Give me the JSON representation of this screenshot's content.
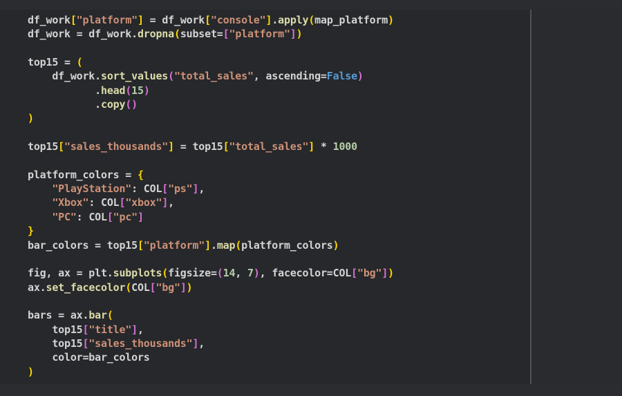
{
  "editor": {
    "background": "#26282B",
    "top_strip_color": "#2B2C2F",
    "bottom_strip_color": "#2B2C2F",
    "right_pane_color": "#292B2E",
    "ruler_color": "#4E5257",
    "token_styles": {
      "v": "default-text",
      "s": "string",
      "f": "function",
      "n": "number",
      "k": "keyword-constant",
      "b1": "bracket-level-1",
      "b2": "bracket-level-2"
    },
    "colors": {
      "v": "#D4D4D4",
      "s": "#CE9178",
      "f": "#DCDCAA",
      "n": "#B5CEA8",
      "k": "#569CD6",
      "b1": "#FFD700",
      "b2": "#D670D6"
    },
    "lines": [
      [
        [
          "df_work",
          "v"
        ],
        [
          "[",
          "b1"
        ],
        [
          "\"platform\"",
          "s"
        ],
        [
          "]",
          "b1"
        ],
        [
          " = df_work",
          "v"
        ],
        [
          "[",
          "b1"
        ],
        [
          "\"console\"",
          "s"
        ],
        [
          "]",
          "b1"
        ],
        [
          ".",
          "v"
        ],
        [
          "apply",
          "f"
        ],
        [
          "(",
          "b1"
        ],
        [
          "map_platform",
          "v"
        ],
        [
          ")",
          "b1"
        ]
      ],
      [
        [
          "df_work = df_work.",
          "v"
        ],
        [
          "dropna",
          "f"
        ],
        [
          "(",
          "b1"
        ],
        [
          "subset=",
          "v"
        ],
        [
          "[",
          "b2"
        ],
        [
          "\"platform\"",
          "s"
        ],
        [
          "]",
          "b2"
        ],
        [
          ")",
          "b1"
        ]
      ],
      [],
      [
        [
          "top15 = ",
          "v"
        ],
        [
          "(",
          "b1"
        ]
      ],
      [
        [
          "    df_work.",
          "v"
        ],
        [
          "sort_values",
          "f"
        ],
        [
          "(",
          "b2"
        ],
        [
          "\"total_sales\"",
          "s"
        ],
        [
          ", ascending=",
          "v"
        ],
        [
          "False",
          "k"
        ],
        [
          ")",
          "b2"
        ]
      ],
      [
        [
          "           .",
          "v"
        ],
        [
          "head",
          "f"
        ],
        [
          "(",
          "b2"
        ],
        [
          "15",
          "n"
        ],
        [
          ")",
          "b2"
        ]
      ],
      [
        [
          "           .",
          "v"
        ],
        [
          "copy",
          "f"
        ],
        [
          "(",
          "b2"
        ],
        [
          ")",
          "b2"
        ]
      ],
      [
        [
          ")",
          "b1"
        ]
      ],
      [],
      [
        [
          "top15",
          "v"
        ],
        [
          "[",
          "b1"
        ],
        [
          "\"sales_thousands\"",
          "s"
        ],
        [
          "]",
          "b1"
        ],
        [
          " = top15",
          "v"
        ],
        [
          "[",
          "b1"
        ],
        [
          "\"total_sales\"",
          "s"
        ],
        [
          "]",
          "b1"
        ],
        [
          " * ",
          "v"
        ],
        [
          "1000",
          "n"
        ]
      ],
      [],
      [
        [
          "platform_colors = ",
          "v"
        ],
        [
          "{",
          "b1"
        ]
      ],
      [
        [
          "    ",
          "v"
        ],
        [
          "\"PlayStation\"",
          "s"
        ],
        [
          ": COL",
          "v"
        ],
        [
          "[",
          "b2"
        ],
        [
          "\"ps\"",
          "s"
        ],
        [
          "]",
          "b2"
        ],
        [
          ",",
          "v"
        ]
      ],
      [
        [
          "    ",
          "v"
        ],
        [
          "\"Xbox\"",
          "s"
        ],
        [
          ": COL",
          "v"
        ],
        [
          "[",
          "b2"
        ],
        [
          "\"xbox\"",
          "s"
        ],
        [
          "]",
          "b2"
        ],
        [
          ",",
          "v"
        ]
      ],
      [
        [
          "    ",
          "v"
        ],
        [
          "\"PC\"",
          "s"
        ],
        [
          ": COL",
          "v"
        ],
        [
          "[",
          "b2"
        ],
        [
          "\"pc\"",
          "s"
        ],
        [
          "]",
          "b2"
        ]
      ],
      [
        [
          "}",
          "b1"
        ]
      ],
      [
        [
          "bar_colors = top15",
          "v"
        ],
        [
          "[",
          "b1"
        ],
        [
          "\"platform\"",
          "s"
        ],
        [
          "]",
          "b1"
        ],
        [
          ".",
          "v"
        ],
        [
          "map",
          "f"
        ],
        [
          "(",
          "b1"
        ],
        [
          "platform_colors",
          "v"
        ],
        [
          ")",
          "b1"
        ]
      ],
      [],
      [
        [
          "fig, ax = plt.",
          "v"
        ],
        [
          "subplots",
          "f"
        ],
        [
          "(",
          "b1"
        ],
        [
          "figsize=",
          "v"
        ],
        [
          "(",
          "b2"
        ],
        [
          "14",
          "n"
        ],
        [
          ", ",
          "v"
        ],
        [
          "7",
          "n"
        ],
        [
          ")",
          "b2"
        ],
        [
          ", facecolor=COL",
          "v"
        ],
        [
          "[",
          "b2"
        ],
        [
          "\"bg\"",
          "s"
        ],
        [
          "]",
          "b2"
        ],
        [
          ")",
          "b1"
        ]
      ],
      [
        [
          "ax.",
          "v"
        ],
        [
          "set_facecolor",
          "f"
        ],
        [
          "(",
          "b1"
        ],
        [
          "COL",
          "v"
        ],
        [
          "[",
          "b2"
        ],
        [
          "\"bg\"",
          "s"
        ],
        [
          "]",
          "b2"
        ],
        [
          ")",
          "b1"
        ]
      ],
      [],
      [
        [
          "bars = ax.",
          "v"
        ],
        [
          "bar",
          "f"
        ],
        [
          "(",
          "b1"
        ]
      ],
      [
        [
          "    top15",
          "v"
        ],
        [
          "[",
          "b2"
        ],
        [
          "\"title\"",
          "s"
        ],
        [
          "]",
          "b2"
        ],
        [
          ",",
          "v"
        ]
      ],
      [
        [
          "    top15",
          "v"
        ],
        [
          "[",
          "b2"
        ],
        [
          "\"sales_thousands\"",
          "s"
        ],
        [
          "]",
          "b2"
        ],
        [
          ",",
          "v"
        ]
      ],
      [
        [
          "    color=bar_colors",
          "v"
        ]
      ],
      [
        [
          ")",
          "b1"
        ]
      ]
    ]
  }
}
